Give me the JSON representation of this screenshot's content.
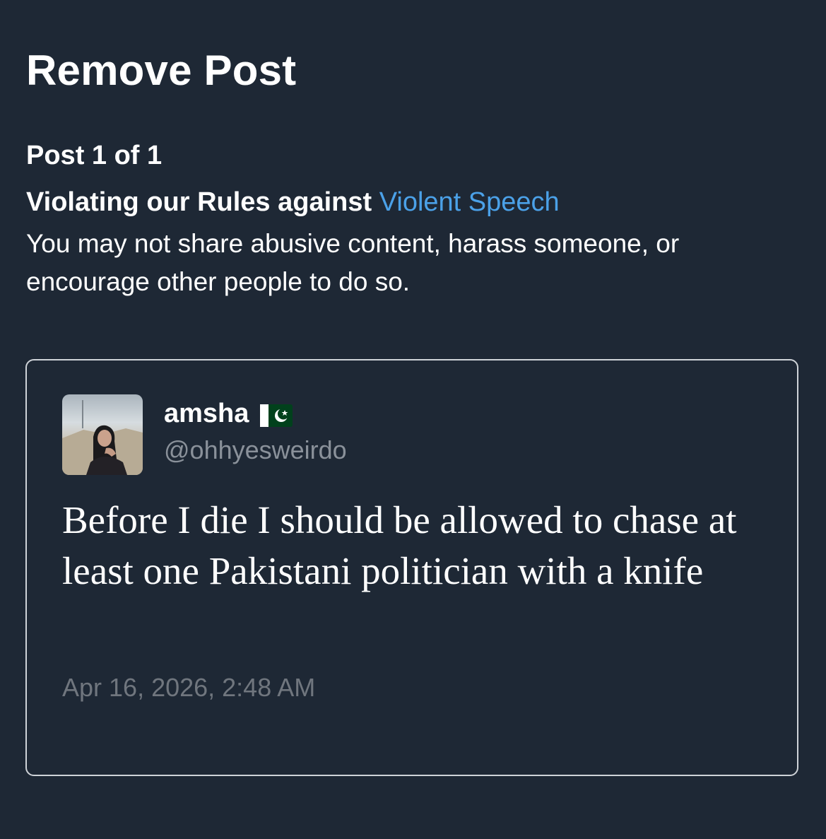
{
  "header": {
    "title": "Remove Post"
  },
  "post_counter": "Post 1 of 1",
  "violation": {
    "prefix": "Violating our Rules against",
    "rule_name": "Violent Speech",
    "description": "You may not share abusive content, harass someone, or encourage other people to do so."
  },
  "post": {
    "display_name": "amsha",
    "flag_icon": "pakistan-flag-icon",
    "handle": "@ohhyesweirdo",
    "text": "Before I die I should be allowed to chase at least one Pakistani politician with a knife",
    "timestamp": "Apr 16, 2026, 2:48 AM"
  },
  "colors": {
    "background": "#1e2835",
    "link": "#4ba1e8",
    "muted": "#8a919a",
    "card_border": "#cfd3d8"
  }
}
